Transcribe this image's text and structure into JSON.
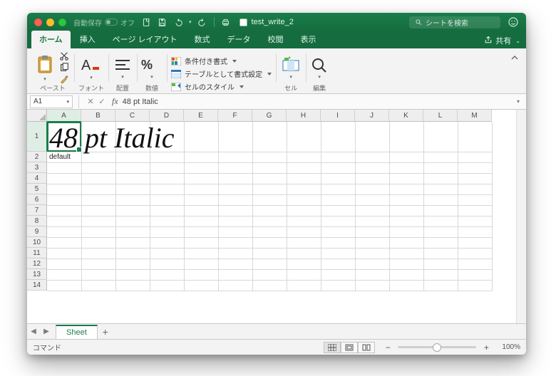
{
  "titlebar": {
    "autosave_label": "自動保存",
    "autosave_state": "オフ",
    "doc_title": "test_write_2",
    "search_placeholder": "シートを検索"
  },
  "tabs": {
    "items": [
      "ホーム",
      "挿入",
      "ページ レイアウト",
      "数式",
      "データ",
      "校閲",
      "表示"
    ],
    "active_index": 0,
    "share_label": "共有"
  },
  "ribbon": {
    "paste_label": "ペースト",
    "font_label": "フォント",
    "align_label": "配置",
    "number_label": "数値",
    "cond_fmt": "条件付き書式",
    "table_fmt": "テーブルとして書式設定",
    "cell_styles": "セルのスタイル",
    "cell_label": "セル",
    "edit_label": "編集"
  },
  "formula": {
    "namebox": "A1",
    "fx": "fx",
    "value": "48 pt Italic"
  },
  "grid": {
    "columns": [
      "A",
      "B",
      "C",
      "D",
      "E",
      "F",
      "G",
      "H",
      "I",
      "J",
      "K",
      "L",
      "M"
    ],
    "row_count": 14,
    "selected_cell": "A1",
    "cells": {
      "A1": {
        "value": "48 pt Italic",
        "font_size": 48,
        "italic": true
      },
      "A2": {
        "value": "default"
      }
    }
  },
  "sheettabs": {
    "active": "Sheet"
  },
  "status": {
    "left": "コマンド",
    "zoom": "100%"
  }
}
